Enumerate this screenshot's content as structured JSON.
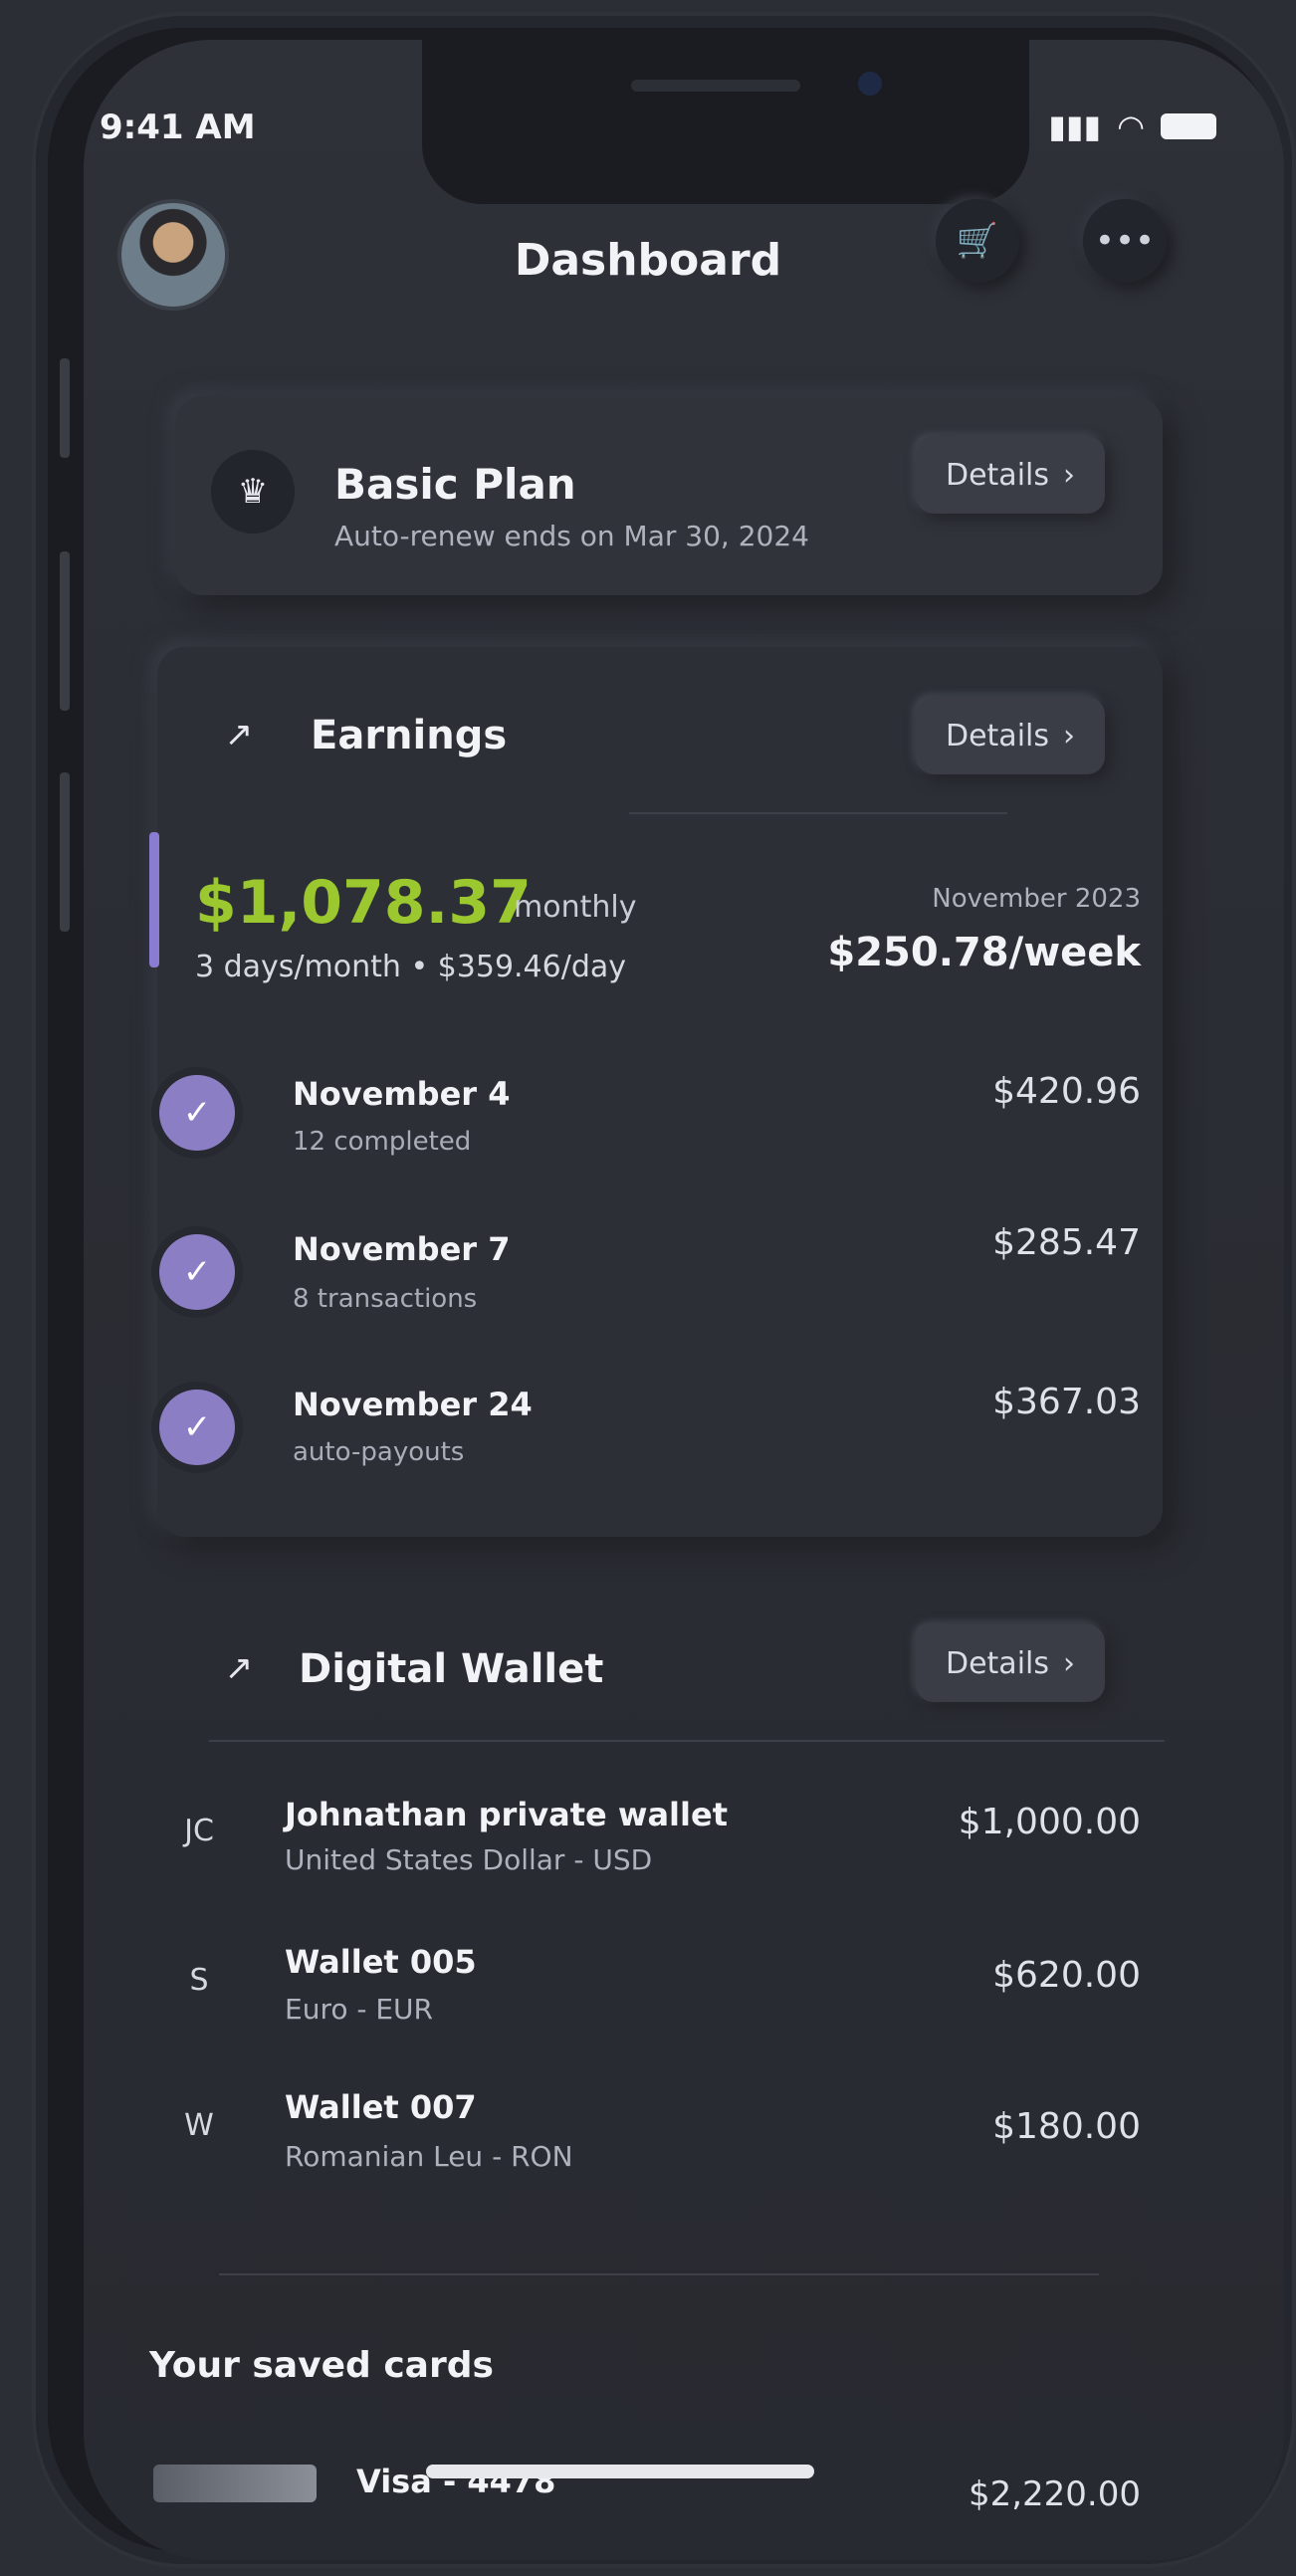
{
  "status_bar": {
    "time": "9:41 AM",
    "signal": "▮▮▮",
    "wifi": "◠"
  },
  "header": {
    "title": "Dashboard",
    "cart_icon": "cart-icon",
    "more_icon": "more-icon",
    "cart_glyph": "🛒",
    "more_glyph": "•••"
  },
  "plan": {
    "icon_glyph": "♛",
    "name": "Basic Plan",
    "renewal": "Auto-renew ends on Mar 30, 2024",
    "details_label": "Details"
  },
  "earnings": {
    "title": "Earnings",
    "icon_glyph": "↗",
    "details_label": "Details",
    "amount": "$1,078.37",
    "amount_suffix": "monthly",
    "average": "3 days/month • $359.46/day",
    "period": "November 2023",
    "weekly": "$250.78/week",
    "entries": [
      {
        "date": "November 4",
        "note": "12 completed",
        "value": "$420.96"
      },
      {
        "date": "November 7",
        "note": "8 transactions",
        "value": "$285.47"
      },
      {
        "date": "November 24",
        "note": "auto-payouts",
        "value": "$367.03"
      }
    ]
  },
  "wallet": {
    "title": "Digital Wallet",
    "icon_glyph": "↗",
    "details_label": "Details",
    "items": [
      {
        "letter": "JC",
        "name": "Johnathan private wallet",
        "sub": "United States Dollar - USD",
        "value": "$1,000.00"
      },
      {
        "letter": "S",
        "name": "Wallet 005",
        "sub": "Euro - EUR",
        "value": "$620.00"
      },
      {
        "letter": "W",
        "name": "Wallet 007",
        "sub": "Romanian Leu - RON",
        "value": "$180.00"
      }
    ]
  },
  "saved_cards": {
    "title": "Your saved cards",
    "cards": [
      {
        "label": "Visa - 4478",
        "value": "$2,220.00"
      }
    ]
  },
  "colors": {
    "accent_green": "#9bc72f",
    "accent_purple": "#8b7ec4",
    "background": "#2b2e34"
  }
}
